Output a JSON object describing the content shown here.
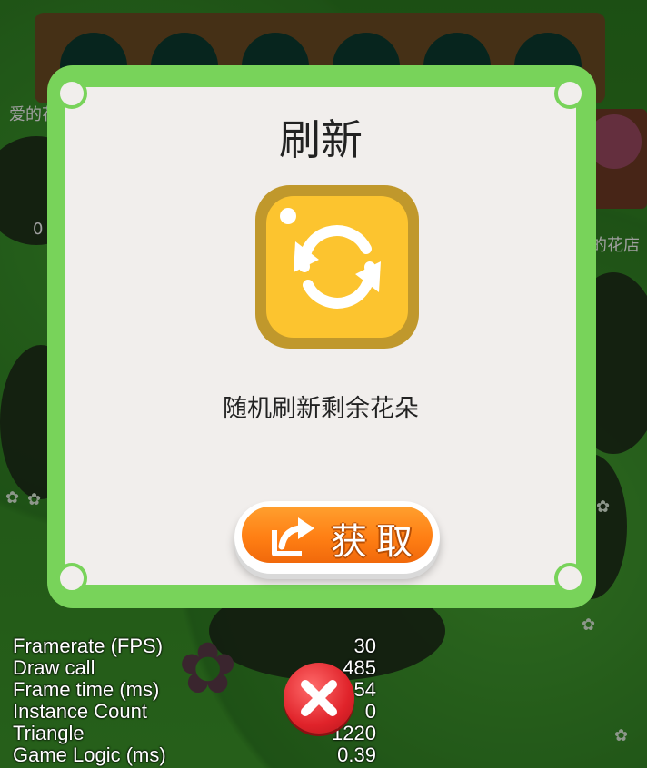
{
  "background": {
    "left_caption": "爱的花",
    "right_caption": "的花店",
    "counter_fragment": "0"
  },
  "dialog": {
    "title": "刷新",
    "icon": "refresh-icon",
    "description": "随机刷新剩余花朵",
    "button_label": "获取",
    "button_icon": "share-icon",
    "colors": {
      "border": "#78d35a",
      "panel": "#f1eeec",
      "icon_face": "#fcc42f",
      "icon_rim": "#c0982c",
      "button": "#ff8a1e"
    }
  },
  "stats": [
    {
      "label": "Framerate (FPS)",
      "value": "30"
    },
    {
      "label": "Draw call",
      "value": "485"
    },
    {
      "label": "Frame time (ms)",
      "value": "2.54"
    },
    {
      "label": "Instance Count",
      "value": "0"
    },
    {
      "label": "Triangle",
      "value": "1220"
    },
    {
      "label": "Game Logic (ms)",
      "value": "0.39"
    }
  ],
  "close_button": {
    "icon": "close-icon",
    "color": "#e0232a"
  }
}
